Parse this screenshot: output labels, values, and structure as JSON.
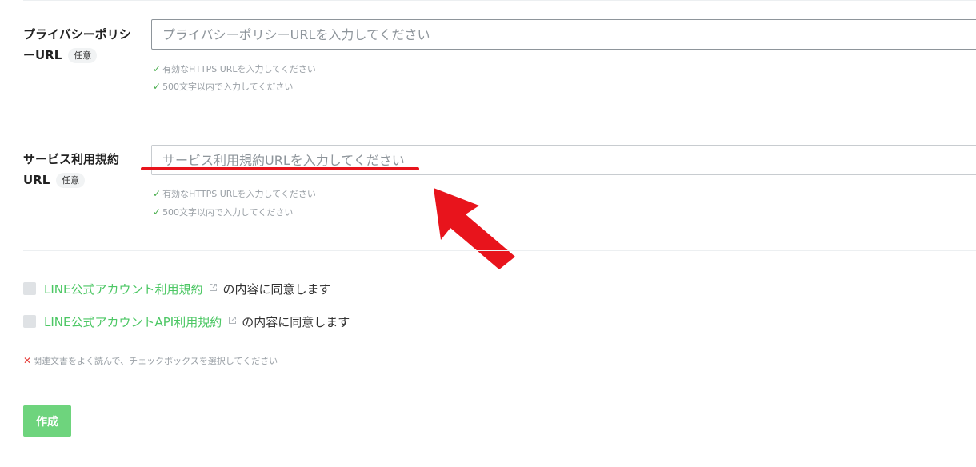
{
  "privacy": {
    "label_line1": "プライバシーポリシ",
    "label_line2": "ーURL",
    "optional_badge": "任意",
    "placeholder": "プライバシーポリシーURLを入力してください",
    "hints": [
      "有効なHTTPS URLを入力してください",
      "500文字以内で入力してください"
    ]
  },
  "terms": {
    "label_line1": "サービス利用規約",
    "label_line2": "URL",
    "optional_badge": "任意",
    "placeholder": "サービス利用規約URLを入力してください",
    "hints": [
      "有効なHTTPS URLを入力してください",
      "500文字以内で入力してください"
    ]
  },
  "agreements": [
    {
      "link_text": "LINE公式アカウント利用規約",
      "suffix": "の内容に同意します",
      "checked": false
    },
    {
      "link_text": "LINE公式アカウントAPI利用規約",
      "suffix": "の内容に同意します",
      "checked": false
    }
  ],
  "error_message": "関連文書をよく読んで、チェックボックスを選択してください",
  "create_button": "作成",
  "colors": {
    "accent_green": "#4cc764",
    "button_green": "#6ed47d",
    "annotation_red": "#e8141c",
    "error_red": "#e53935"
  },
  "icons": {
    "check": "check-icon",
    "external": "external-link-icon",
    "error": "error-x-icon",
    "arrow": "annotation-arrow-icon"
  }
}
